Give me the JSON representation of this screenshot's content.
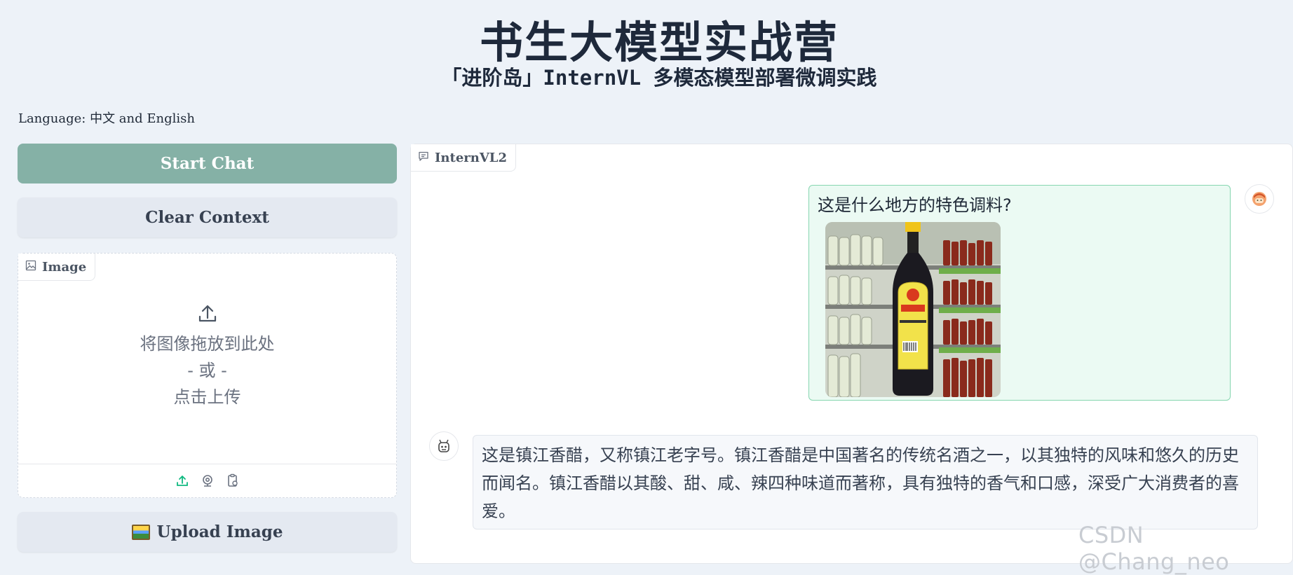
{
  "header": {
    "title": "书生大模型实战营",
    "subtitle": "「进阶岛」InternVL 多模态模型部署微调实践"
  },
  "language_line": "Language: 中文 and English",
  "buttons": {
    "start_chat": "Start Chat",
    "clear_context": "Clear Context",
    "upload_image": "Upload Image"
  },
  "image_panel": {
    "label": "Image",
    "drop_text": "将图像拖放到此处",
    "or_text": "- 或 -",
    "click_text": "点击上传",
    "footer_icons": [
      "upload-icon",
      "webcam-icon",
      "clipboard-icon"
    ]
  },
  "chat": {
    "label": "InternVL2",
    "messages": [
      {
        "role": "user",
        "text": "这是什么地方的特色调料?",
        "image": "vinegar bottle on supermarket shelf"
      },
      {
        "role": "assistant",
        "text": "这是镇江香醋，又称镇江老字号。镇江香醋是中国著名的传统名酒之一，以其独特的风味和悠久的历史而闻名。镇江香醋以其酸、甜、咸、辣四种味道而著称，具有独特的香气和口感，深受广大消费者的喜爱。"
      }
    ]
  },
  "watermark": "CSDN @Chang_neo",
  "colors": {
    "background": "#edf2f8",
    "start_button": "#85b1a6",
    "user_bubble": "#ebfaf3",
    "user_bubble_border": "#86d6b0",
    "accent_icon": "#10b981"
  }
}
